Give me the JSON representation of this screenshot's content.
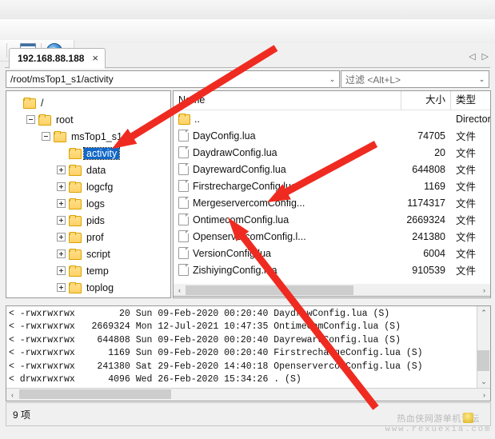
{
  "toolbar": {
    "icons": [
      "window-icon",
      "help-icon"
    ],
    "overflow_label": "☰"
  },
  "tab": {
    "label": "192.168.88.188",
    "close_label": "×",
    "nav_prev": "◁",
    "nav_next": "▷"
  },
  "path_bar": {
    "value": "/root/msTop1_s1/activity",
    "dropdown_arrow": "⌄"
  },
  "filter_bar": {
    "placeholder": "过滤 <Alt+L>",
    "dropdown_arrow": "⌄"
  },
  "tree": {
    "nodes": [
      {
        "label": "/",
        "depth": 0,
        "expander": "none",
        "selected": false
      },
      {
        "label": "root",
        "depth": 1,
        "expander": "minus",
        "selected": false
      },
      {
        "label": "msTop1_s1",
        "depth": 2,
        "expander": "minus",
        "selected": false
      },
      {
        "label": "activity",
        "depth": 3,
        "expander": "none",
        "selected": true
      },
      {
        "label": "data",
        "depth": 3,
        "expander": "plus",
        "selected": false
      },
      {
        "label": "logcfg",
        "depth": 3,
        "expander": "plus",
        "selected": false
      },
      {
        "label": "logs",
        "depth": 3,
        "expander": "plus",
        "selected": false
      },
      {
        "label": "pids",
        "depth": 3,
        "expander": "plus",
        "selected": false
      },
      {
        "label": "prof",
        "depth": 3,
        "expander": "plus",
        "selected": false
      },
      {
        "label": "script",
        "depth": 3,
        "expander": "plus",
        "selected": false
      },
      {
        "label": "temp",
        "depth": 3,
        "expander": "plus",
        "selected": false
      },
      {
        "label": "toplog",
        "depth": 3,
        "expander": "plus",
        "selected": false
      }
    ]
  },
  "file_list": {
    "columns": {
      "name": "Name",
      "size": "大小",
      "type": "类型"
    },
    "rows": [
      {
        "name": "..",
        "size": "",
        "type": "Directory",
        "icon": "folder-icon"
      },
      {
        "name": "DayConfig.lua",
        "size": "74705",
        "type": "文件",
        "icon": "file-icon"
      },
      {
        "name": "DaydrawConfig.lua",
        "size": "20",
        "type": "文件",
        "icon": "file-icon"
      },
      {
        "name": "DayrewardConfig.lua",
        "size": "644808",
        "type": "文件",
        "icon": "file-icon"
      },
      {
        "name": "FirstrechargeConfig.lua",
        "size": "1169",
        "type": "文件",
        "icon": "file-icon"
      },
      {
        "name": "MergeservercomConfig...",
        "size": "1174317",
        "type": "文件",
        "icon": "file-icon"
      },
      {
        "name": "OntimecomConfig.lua",
        "size": "2669324",
        "type": "文件",
        "icon": "file-icon"
      },
      {
        "name": "OpenservercomConfig.l...",
        "size": "241380",
        "type": "文件",
        "icon": "file-icon"
      },
      {
        "name": "VersionConfig.lua",
        "size": "6004",
        "type": "文件",
        "icon": "file-icon"
      },
      {
        "name": "ZishiyingConfig.lua",
        "size": "910539",
        "type": "文件",
        "icon": "file-icon"
      }
    ],
    "hscroll": {
      "left_arrow": "‹",
      "right_arrow": "›"
    }
  },
  "log_panel": {
    "lines": [
      "< -rwxrwxrwx        20 Sun 09-Feb-2020 00:20:40 DaydrawConfig.lua (S)",
      "< -rwxrwxrwx   2669324 Mon 12-Jul-2021 10:47:35 OntimecomConfig.lua (S)",
      "< -rwxrwxrwx    644808 Sun 09-Feb-2020 00:20:40 DayrewardConfig.lua (S)",
      "< -rwxrwxrwx      1169 Sun 09-Feb-2020 00:20:40 FirstrechargeConfig.lua (S)",
      "< -rwxrwxrwx    241380 Sat 29-Feb-2020 14:40:18 OpenservercomConfig.lua (S)",
      "< drwxrwxrwx      4096 Wed 26-Feb-2020 15:34:26 . (S)"
    ],
    "scroll_up": "⌃",
    "scroll_down": "⌄",
    "hscroll_left": "‹",
    "hscroll_right": "›"
  },
  "status_bar": {
    "text": "9 项"
  },
  "watermark": {
    "line1": "热血侠网游单机论坛",
    "line2": "www.rexuexia.com"
  },
  "annotations": {
    "arrow_color": "#ef2b21",
    "arrows": [
      {
        "name": "arrow-to-activity-folder",
        "target": "activity"
      },
      {
        "name": "arrow-to-mergeserver-file",
        "target": "MergeservercomConfig..."
      },
      {
        "name": "arrow-to-ontimecom-file",
        "target": "OntimecomConfig.lua"
      }
    ]
  }
}
